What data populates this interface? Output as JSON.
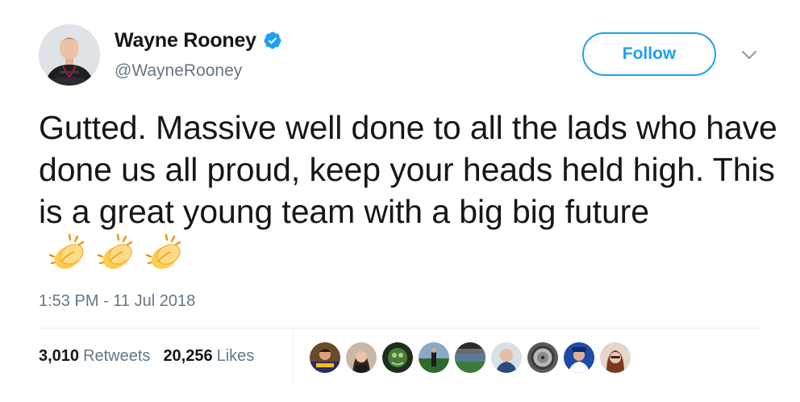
{
  "author": {
    "display_name": "Wayne Rooney",
    "handle": "@WayneRooney",
    "verified": true
  },
  "actions": {
    "follow_label": "Follow"
  },
  "tweet": {
    "text": "Gutted. Massive well done to all the lads who have done us all proud, keep your heads held high. This is a great young team with a big big future",
    "emoji": [
      "clapping-hands",
      "clapping-hands",
      "clapping-hands"
    ],
    "timestamp": "1:53 PM - 11 Jul 2018"
  },
  "stats": {
    "retweets_count": "3,010",
    "retweets_label": "Retweets",
    "likes_count": "20,256",
    "likes_label": "Likes"
  },
  "liker_avatars": [
    {
      "name": "liker-1"
    },
    {
      "name": "liker-2"
    },
    {
      "name": "liker-3"
    },
    {
      "name": "liker-4"
    },
    {
      "name": "liker-5"
    },
    {
      "name": "liker-6"
    },
    {
      "name": "liker-7"
    },
    {
      "name": "liker-8"
    },
    {
      "name": "liker-9"
    }
  ],
  "colors": {
    "accent": "#1da1f2",
    "text_primary": "#14171a",
    "text_secondary": "#657786",
    "divider": "#e6ecf0"
  }
}
